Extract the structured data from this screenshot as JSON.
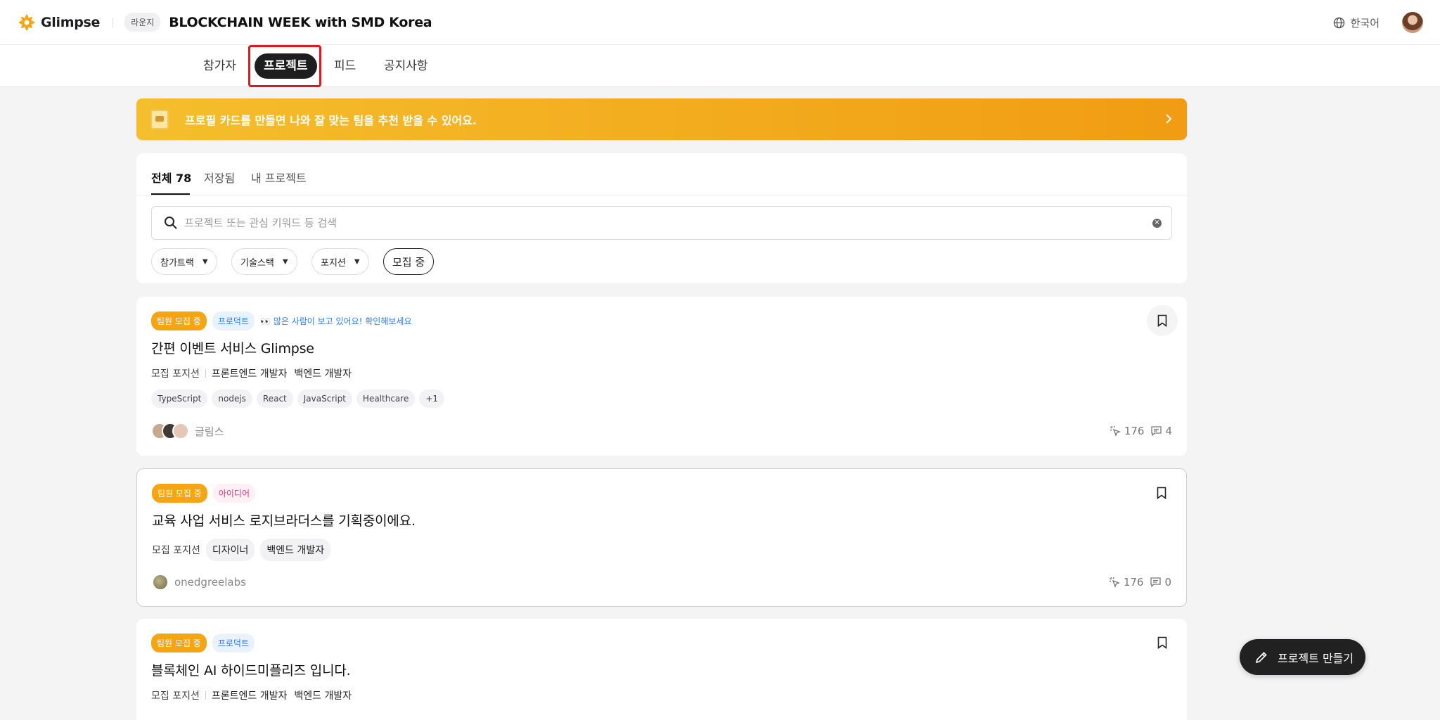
{
  "header": {
    "logo_text": "Glimpse",
    "lounge_badge": "라운지",
    "event_title": "BLOCKCHAIN WEEK with SMD Korea",
    "language": "한국어"
  },
  "nav": {
    "tabs": [
      {
        "label": "참가자"
      },
      {
        "label": "프로젝트",
        "active": true
      },
      {
        "label": "피드"
      },
      {
        "label": "공지사항"
      }
    ]
  },
  "banner": {
    "text": "프로필 카드를 만들면 나와 잘 맞는 팀을 추천 받을 수 있어요."
  },
  "filters": {
    "subtabs": [
      {
        "label": "전체 78",
        "active": true
      },
      {
        "label": "저장됨"
      },
      {
        "label": "내 프로젝트"
      }
    ],
    "search_placeholder": "프로젝트 또는 관심 키워드 등 검색",
    "chips": [
      "참가트랙",
      "기술스택",
      "포지션"
    ],
    "toggle": "모집 중"
  },
  "projects": [
    {
      "badges": [
        "팀원 모집 중",
        "프로덕트"
      ],
      "hot_note": "많은 사람이 보고 있어요! 확인해보세요",
      "title": "간편 이벤트 서비스 Glimpse",
      "position_label": "모집 포지션",
      "positions": [
        "프론트엔드 개발자",
        "백엔드 개발자"
      ],
      "tags": [
        "TypeScript",
        "nodejs",
        "React",
        "JavaScript",
        "Healthcare",
        "+1"
      ],
      "author": "글림스",
      "views": "176",
      "comments": "4"
    },
    {
      "badges": [
        "팀원 모집 중",
        "아이디어"
      ],
      "title": "교육 사업 서비스 로지브라더스를 기획중이에요.",
      "position_label": "모집 포지션",
      "positions": [
        "디자이너",
        "백엔드 개발자"
      ],
      "author": "onedgreelabs",
      "views": "176",
      "comments": "0"
    },
    {
      "badges": [
        "팀원 모집 중",
        "프로덕트"
      ],
      "title": "블록체인 AI 하이드미플리즈 입니다.",
      "position_label": "모집 포지션",
      "positions": [
        "프론트엔드 개발자",
        "백엔드 개발자"
      ]
    }
  ],
  "fab": {
    "label": "프로젝트 만들기"
  },
  "colors": {
    "accent": "#f5a414",
    "highlight": "#e8141b"
  }
}
